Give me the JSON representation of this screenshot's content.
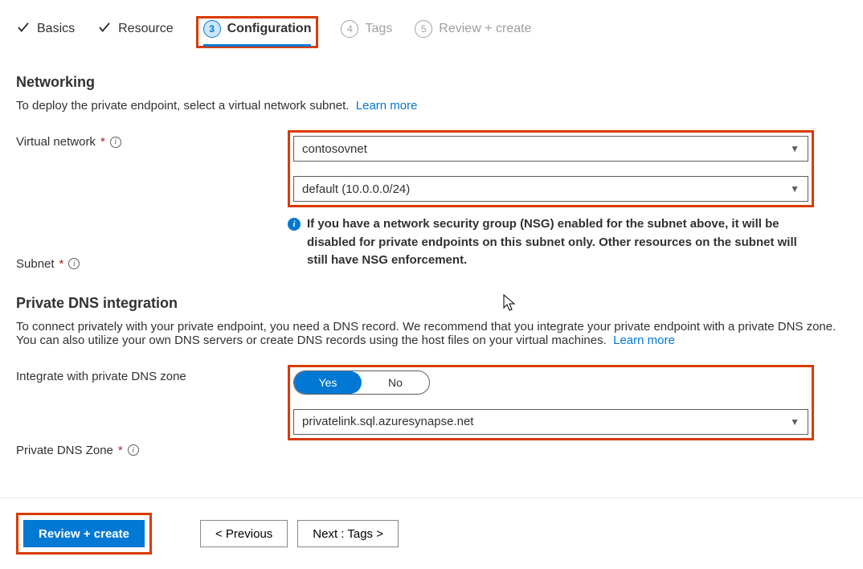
{
  "tabs": {
    "basics": "Basics",
    "resource": "Resource",
    "config": "Configuration",
    "config_num": "3",
    "tags": "Tags",
    "tags_num": "4",
    "review": "Review + create",
    "review_num": "5"
  },
  "networking": {
    "heading": "Networking",
    "desc": "To deploy the private endpoint, select a virtual network subnet.",
    "learn_more": "Learn more",
    "vnet_label": "Virtual network",
    "vnet_value": "contosovnet",
    "subnet_label": "Subnet",
    "subnet_value": "default (10.0.0.0/24)",
    "nsg_info": "If you have a network security group (NSG) enabled for the subnet above, it will be disabled for private endpoints on this subnet only. Other resources on the subnet will still have NSG enforcement."
  },
  "dns": {
    "heading": "Private DNS integration",
    "desc": "To connect privately with your private endpoint, you need a DNS record. We recommend that you integrate your private endpoint with a private DNS zone. You can also utilize your own DNS servers or create DNS records using the host files on your virtual machines.",
    "learn_more": "Learn more",
    "integrate_label": "Integrate with private DNS zone",
    "yes": "Yes",
    "no": "No",
    "zone_label": "Private DNS Zone",
    "zone_value": "privatelink.sql.azuresynapse.net"
  },
  "footer": {
    "review": "Review + create",
    "prev": "< Previous",
    "next": "Next : Tags >"
  }
}
